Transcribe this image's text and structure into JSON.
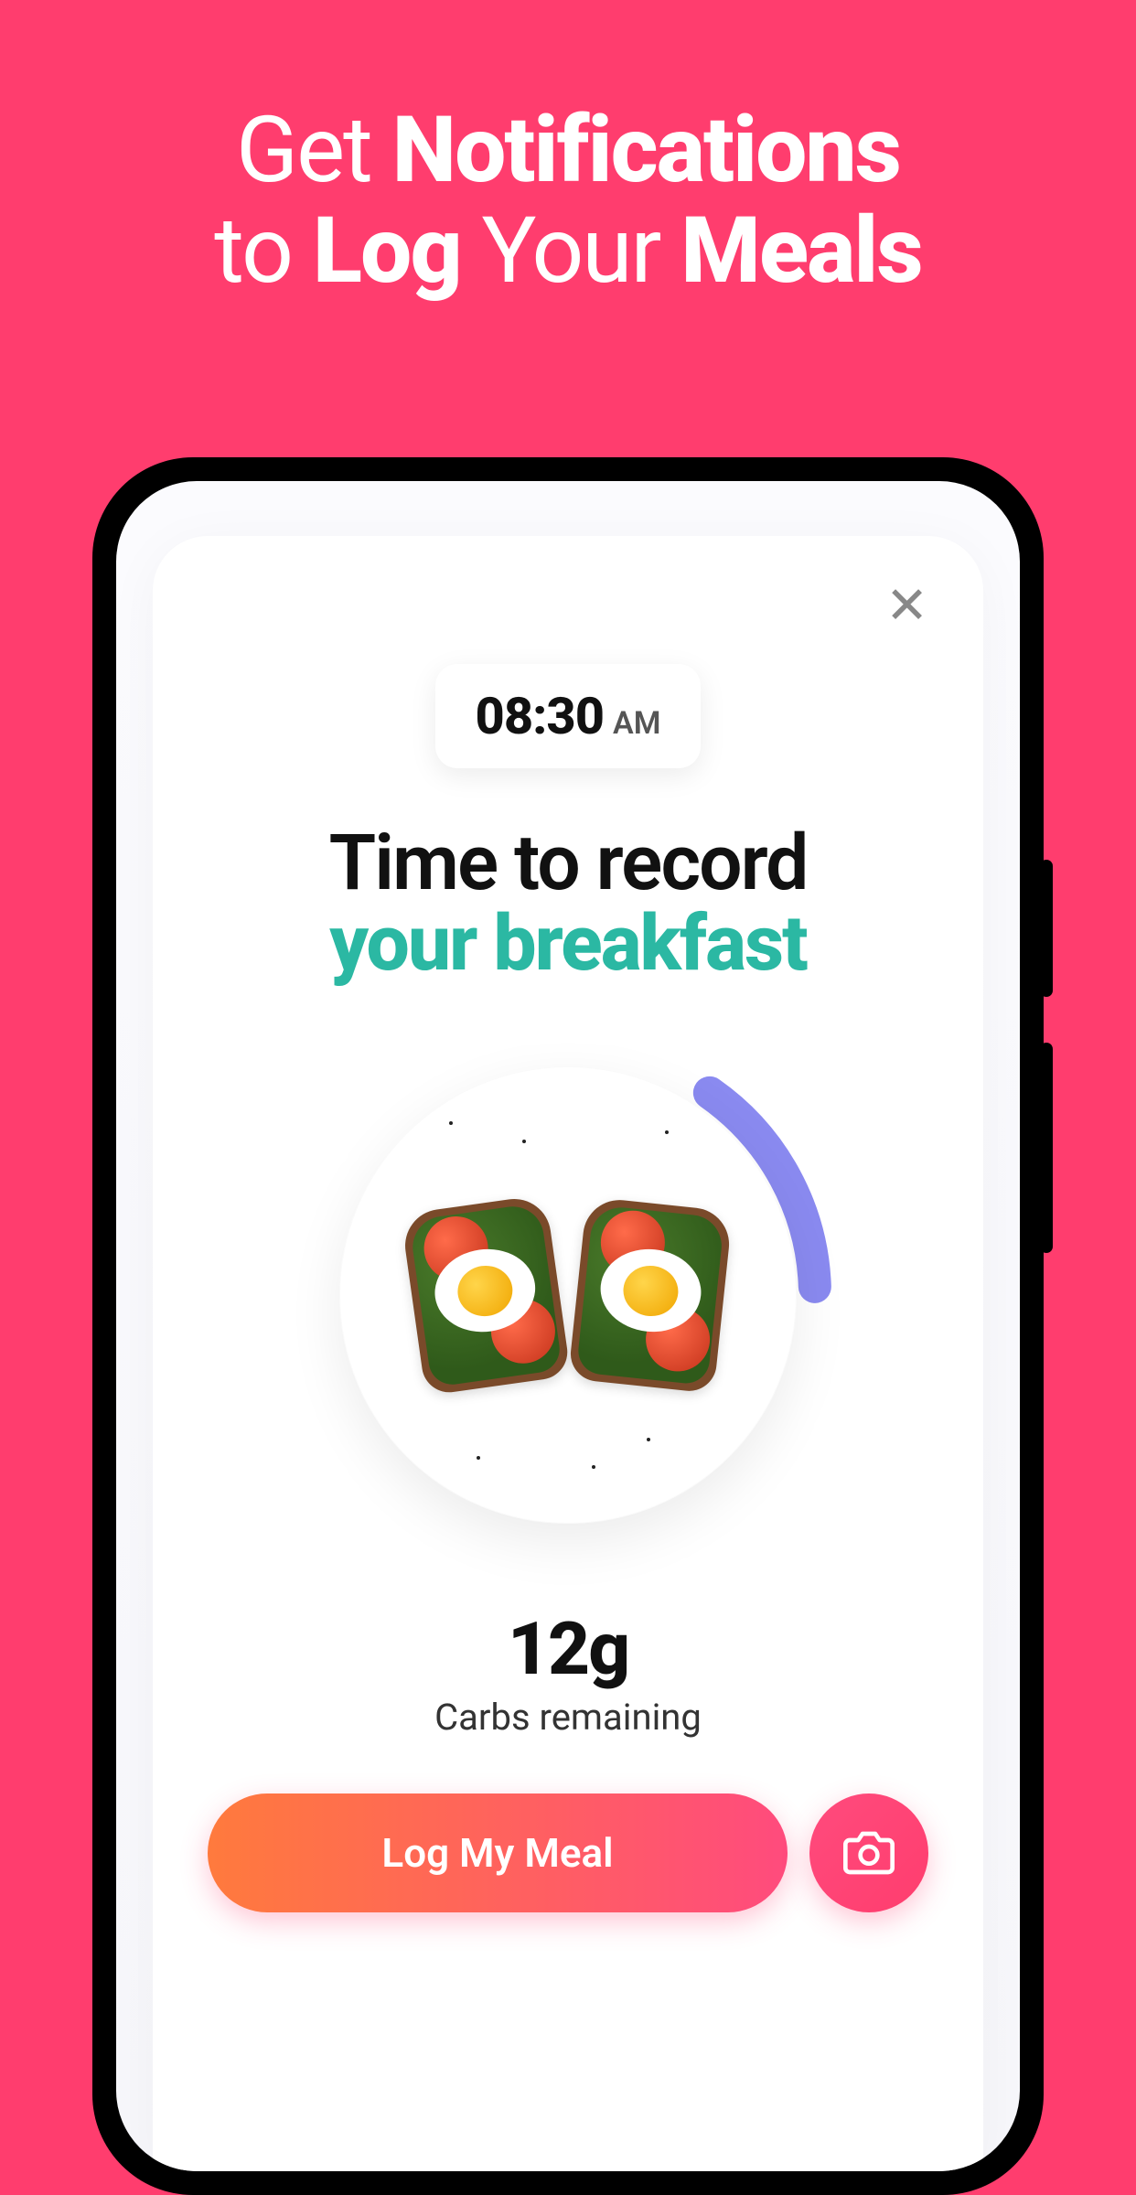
{
  "hero": {
    "line1_prefix": "Get ",
    "line1_bold": "Notifications",
    "line2_prefix": "to ",
    "line2_bold1": "Log",
    "line2_mid": " Your ",
    "line2_bold2": "Meals"
  },
  "card": {
    "time": "08:30",
    "ampm": "AM",
    "prompt_line1": "Time to record",
    "prompt_line2": "your breakfast",
    "metric_value": "12g",
    "metric_label": "Carbs remaining",
    "log_button": "Log My Meal"
  }
}
